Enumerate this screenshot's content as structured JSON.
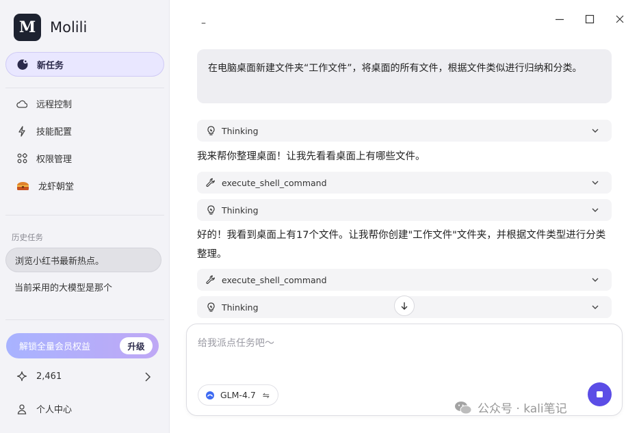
{
  "app": {
    "name": "Molili",
    "logo_letter": "M"
  },
  "sidebar": {
    "new_task_label": "新任务",
    "nav": [
      {
        "label": "远程控制",
        "icon": "cloud-icon"
      },
      {
        "label": "技能配置",
        "icon": "lightning-icon"
      },
      {
        "label": "权限管理",
        "icon": "apps-grid-icon"
      },
      {
        "label": "龙虾朝堂",
        "icon": "treasure-chest-icon"
      }
    ],
    "history_title": "历史任务",
    "history": [
      {
        "label": "浏览小红书最新热点。",
        "active": true
      },
      {
        "label": "当前采用的大模型是那个",
        "active": false
      }
    ],
    "upgrade": {
      "text": "解锁全量会员权益",
      "button": "升级"
    },
    "credits": "2,461",
    "profile": "个人中心"
  },
  "window": {
    "minimize": "minimize-icon",
    "maximize": "maximize-icon",
    "close": "close-icon",
    "top_dash": "–"
  },
  "chat": {
    "user_message": "在电脑桌面新建文件夹“工作文件”，将桌面的所有文件，根据文件类似进行归纳和分类。",
    "blocks": [
      {
        "type": "tool",
        "label": "Thinking",
        "icon": "bulb-icon"
      },
      {
        "type": "text",
        "text": "我来帮你整理桌面！让我先看看桌面上有哪些文件。"
      },
      {
        "type": "tool",
        "label": "execute_shell_command",
        "icon": "wrench-icon"
      },
      {
        "type": "tool",
        "label": "Thinking",
        "icon": "bulb-icon"
      },
      {
        "type": "text",
        "text": "好的！我看到桌面上有17个文件。让我帮你创建\"工作文件\"文件夹，并根据文件类型进行分类整理。"
      },
      {
        "type": "tool",
        "label": "execute_shell_command",
        "icon": "wrench-icon"
      },
      {
        "type": "tool",
        "label": "Thinking",
        "icon": "bulb-icon"
      }
    ]
  },
  "composer": {
    "placeholder": "给我派点任务吧～",
    "model": "GLM-4.7",
    "swap_glyph": "⇋"
  },
  "watermark": {
    "text": "公众号 · kali笔记"
  },
  "colors": {
    "accent": "#5b4de6",
    "sidebar_bg": "#f3f3f7",
    "bubble_bg": "#eeeef2"
  }
}
